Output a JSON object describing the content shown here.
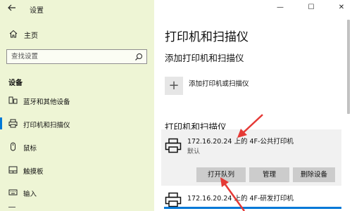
{
  "window": {
    "title": "设置",
    "back_icon": "arrow-left-icon",
    "minimize_glyph": "—",
    "maximize_glyph": "☐",
    "close_glyph": "✕"
  },
  "sidebar": {
    "home_label": "主页",
    "search_placeholder": "查找设置",
    "section_heading": "设备",
    "items": [
      {
        "label": "蓝牙和其他设备",
        "icon": "bluetooth-devices-icon"
      },
      {
        "label": "打印机和扫描仪",
        "icon": "printer-icon",
        "selected": true
      },
      {
        "label": "鼠标",
        "icon": "mouse-icon"
      },
      {
        "label": "触摸板",
        "icon": "touchpad-icon"
      },
      {
        "label": "输入",
        "icon": "keyboard-icon"
      }
    ]
  },
  "main": {
    "title": "打印机和扫描仪",
    "add_heading": "添加打印机和扫描仪",
    "add_button_label": "添加打印机或扫描仪",
    "list_heading": "打印机和扫描仪",
    "printers": [
      {
        "name": "172.16.20.24 上的 4F-公共打印机",
        "status": "默认",
        "expanded": true
      },
      {
        "name": "172.16.20.24 上的 4F-研发打印机"
      }
    ],
    "actions": {
      "open_queue": "打开队列",
      "manage": "管理",
      "remove_device": "删除设备"
    }
  },
  "colors": {
    "sidebar_bg": "#eef5d5",
    "accent": "#0078d7",
    "card_bg": "#f1f1f1",
    "button_bg": "#cccccc",
    "annotation_arrow": "#e53935"
  }
}
